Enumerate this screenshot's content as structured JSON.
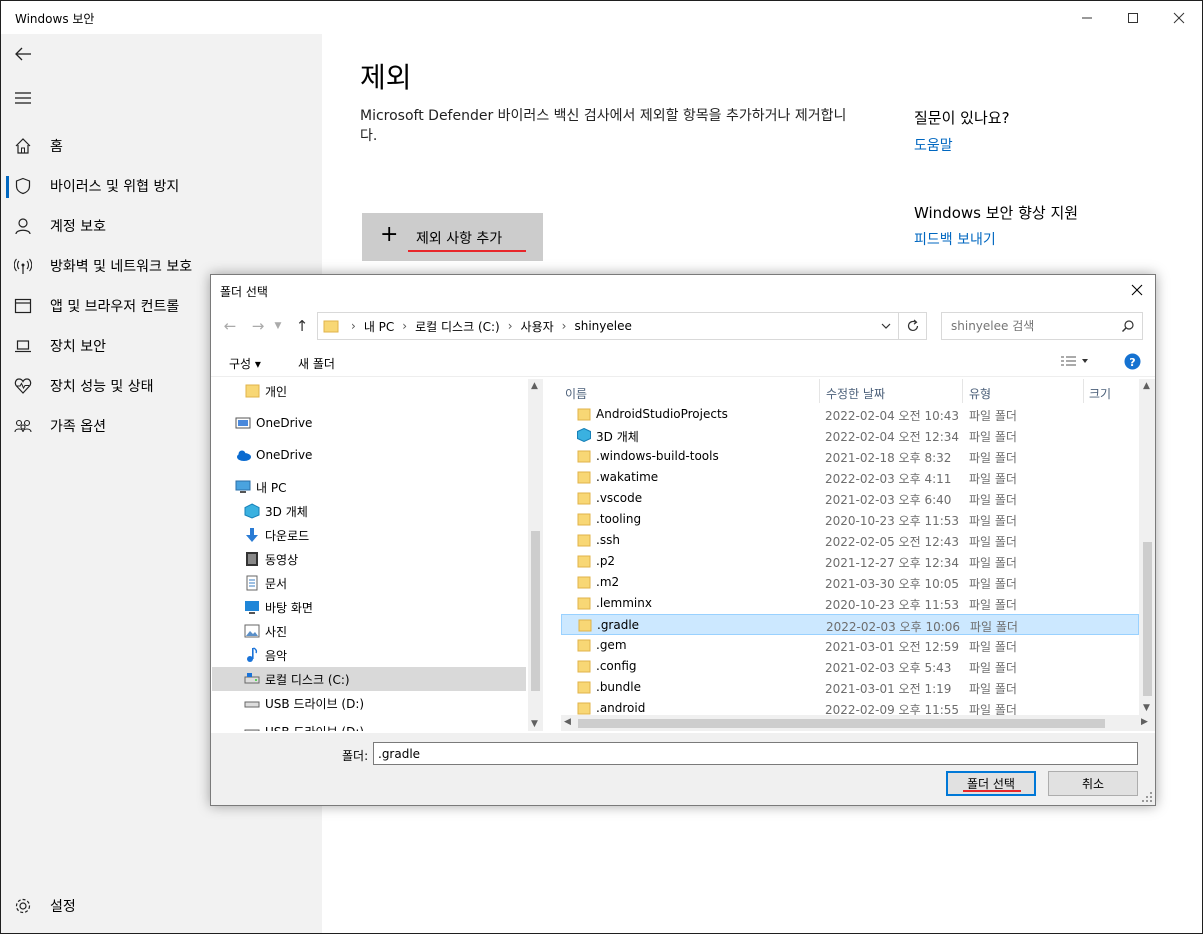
{
  "window": {
    "title": "Windows 보안"
  },
  "sidebar": {
    "items": [
      {
        "label": "홈",
        "icon": "home-icon"
      },
      {
        "label": "바이러스 및 위협 방지",
        "icon": "shield-icon"
      },
      {
        "label": "계정 보호",
        "icon": "person-icon"
      },
      {
        "label": "방화벽 및 네트워크 보호",
        "icon": "wifi-antenna-icon"
      },
      {
        "label": "앱 및 브라우저 컨트롤",
        "icon": "app-window-icon"
      },
      {
        "label": "장치 보안",
        "icon": "laptop-icon"
      },
      {
        "label": "장치 성능 및 상태",
        "icon": "heart-icon"
      },
      {
        "label": "가족 옵션",
        "icon": "family-icon"
      }
    ],
    "settings_label": "설정"
  },
  "content": {
    "title": "제외",
    "description": "Microsoft Defender 바이러스 백신 검사에서 제외할 항목을 추가하거나 제거합니다.",
    "add_button": "제외 사항 추가",
    "question_heading": "질문이 있나요?",
    "help_link": "도움말",
    "improve_heading": "Windows 보안 향상 지원",
    "feedback_link": "피드백 보내기"
  },
  "dialog": {
    "title": "폴더 선택",
    "breadcrumbs": [
      "내 PC",
      "로컬 디스크 (C:)",
      "사용자",
      "shinyelee"
    ],
    "search_placeholder": "shinyelee 검색",
    "organize": "구성 ▾",
    "new_folder": "새 폴더",
    "nav_items": [
      {
        "label": "개인",
        "icon": "folder-icon"
      },
      {
        "label": "OneDrive",
        "icon": "onedrive-icon"
      },
      {
        "label": "OneDrive",
        "icon": "onedrive-cloud-icon"
      },
      {
        "label": "내 PC",
        "icon": "computer-icon"
      },
      {
        "label": "3D 개체",
        "icon": "3d-objects-icon"
      },
      {
        "label": "다운로드",
        "icon": "download-icon"
      },
      {
        "label": "동영상",
        "icon": "video-icon"
      },
      {
        "label": "문서",
        "icon": "document-icon"
      },
      {
        "label": "바탕 화면",
        "icon": "desktop-icon"
      },
      {
        "label": "사진",
        "icon": "pictures-icon"
      },
      {
        "label": "음악",
        "icon": "music-icon"
      },
      {
        "label": "로컬 디스크 (C:)",
        "icon": "drive-icon"
      },
      {
        "label": "USB 드라이브 (D:)",
        "icon": "usb-drive-icon"
      },
      {
        "label": "USB 드라이브 (D:)",
        "icon": "usb-drive-icon"
      }
    ],
    "columns": {
      "name": "이름",
      "modified": "수정한 날짜",
      "type": "유형",
      "size": "크기"
    },
    "files": [
      {
        "name": "AndroidStudioProjects",
        "date": "2022-02-04 오전 10:43",
        "type": "파일 폴더"
      },
      {
        "name": "3D 개체",
        "date": "2022-02-04 오전 12:34",
        "type": "파일 폴더"
      },
      {
        "name": ".windows-build-tools",
        "date": "2021-02-18 오후 8:32",
        "type": "파일 폴더"
      },
      {
        "name": ".wakatime",
        "date": "2022-02-03 오후 4:11",
        "type": "파일 폴더"
      },
      {
        "name": ".vscode",
        "date": "2021-02-03 오후 6:40",
        "type": "파일 폴더"
      },
      {
        "name": ".tooling",
        "date": "2020-10-23 오후 11:53",
        "type": "파일 폴더"
      },
      {
        "name": ".ssh",
        "date": "2022-02-05 오전 12:43",
        "type": "파일 폴더"
      },
      {
        "name": ".p2",
        "date": "2021-12-27 오후 12:34",
        "type": "파일 폴더"
      },
      {
        "name": ".m2",
        "date": "2021-03-30 오후 10:05",
        "type": "파일 폴더"
      },
      {
        "name": ".lemminx",
        "date": "2020-10-23 오후 11:53",
        "type": "파일 폴더"
      },
      {
        "name": ".gradle",
        "date": "2022-02-03 오후 10:06",
        "type": "파일 폴더"
      },
      {
        "name": ".gem",
        "date": "2021-03-01 오전 12:59",
        "type": "파일 폴더"
      },
      {
        "name": ".config",
        "date": "2021-02-03 오후 5:43",
        "type": "파일 폴더"
      },
      {
        "name": ".bundle",
        "date": "2021-03-01 오전 1:19",
        "type": "파일 폴더"
      },
      {
        "name": ".android",
        "date": "2022-02-09 오후 11:55",
        "type": "파일 폴더"
      }
    ],
    "folder_label": "폴더:",
    "folder_value": ".gradle",
    "select_button": "폴더 선택",
    "cancel_button": "취소"
  },
  "colors": {
    "accent": "#0067c0",
    "underline": "#e8262a",
    "selection": "#cce8ff",
    "folder": "#f8d775"
  }
}
